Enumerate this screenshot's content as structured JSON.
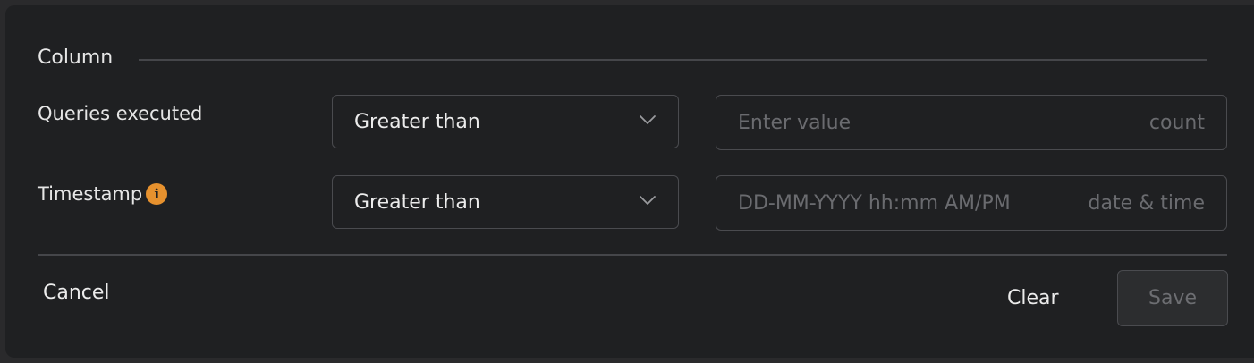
{
  "section": {
    "title": "Column"
  },
  "rows": [
    {
      "label": "Queries executed",
      "operator": "Greater than",
      "value_placeholder": "Enter value",
      "unit": "count"
    },
    {
      "label": "Timestamp",
      "info_icon": "info-icon",
      "operator": "Greater than",
      "value_placeholder": "DD-MM-YYYY hh:mm AM/PM",
      "unit": "date & time"
    }
  ],
  "footer": {
    "cancel_label": "Cancel",
    "clear_label": "Clear",
    "save_label": "Save"
  },
  "colors": {
    "panel_bg": "#1f2022",
    "border": "#4a4b4f",
    "info_accent": "#e6912e"
  }
}
